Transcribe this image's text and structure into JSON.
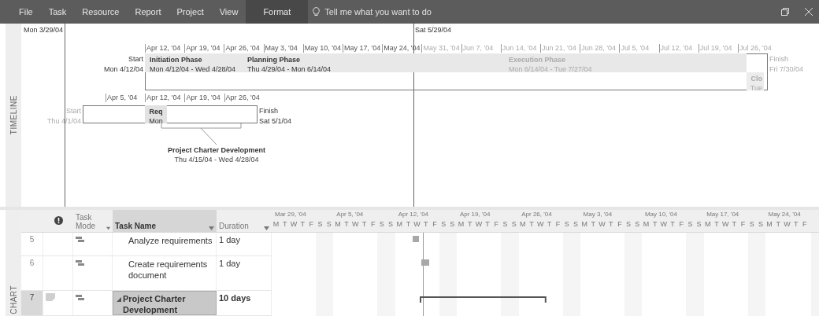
{
  "ribbon": {
    "tabs": [
      {
        "label": "File",
        "selected": false
      },
      {
        "label": "Task",
        "selected": false
      },
      {
        "label": "Resource",
        "selected": false
      },
      {
        "label": "Report",
        "selected": false
      },
      {
        "label": "Project",
        "selected": false
      },
      {
        "label": "View",
        "selected": false
      },
      {
        "label": "Format",
        "selected": true
      }
    ],
    "tell_me": {
      "placeholder": "Tell me what you want to do"
    }
  },
  "timeline": {
    "label": "TIMELINE",
    "left_date": "Mon 3/29/04",
    "marker_date": "Sat 5/29/04",
    "bars": [
      {
        "ticks": [
          {
            "label": "Apr 12, '04",
            "dimmed": false
          },
          {
            "label": "Apr 19, '04",
            "dimmed": false
          },
          {
            "label": "Apr 26, '04",
            "dimmed": false
          },
          {
            "label": "May 3, '04",
            "dimmed": false
          },
          {
            "label": "May 10, '04",
            "dimmed": false
          },
          {
            "label": "May 17, '04",
            "dimmed": false
          },
          {
            "label": "May 24, '04",
            "dimmed": false
          },
          {
            "label": "May 31, '04",
            "dimmed": true
          },
          {
            "label": "Jun 7, '04",
            "dimmed": true
          },
          {
            "label": "Jun 14, '04",
            "dimmed": true
          },
          {
            "label": "Jun 21, '04",
            "dimmed": true
          },
          {
            "label": "Jun 28, '04",
            "dimmed": true
          },
          {
            "label": "Jul 5, '04",
            "dimmed": true
          },
          {
            "label": "Jul 12, '04",
            "dimmed": true
          },
          {
            "label": "Jul 19, '04",
            "dimmed": true
          },
          {
            "label": "Jul 26, '04",
            "dimmed": true
          }
        ],
        "start_label": "Start",
        "start_date": "Mon 4/12/04",
        "start_dimmed": false,
        "finish_label": "Finish",
        "finish_date": "Fri 7/30/04",
        "finish_dimmed": true,
        "tasks": [
          {
            "name": "Initiation Phase",
            "dates": "Mon 4/12/04 - Wed 4/28/04",
            "dimmed": false
          },
          {
            "name": "Planning Phase",
            "dates": "Thu 4/29/04 - Mon 6/14/04",
            "dimmed": false
          },
          {
            "name": "Execution Phase",
            "dates": "Mon 6/14/04 - Tue 7/27/04",
            "dimmed": true
          },
          {
            "name": "Clo",
            "dates": "Tue",
            "dimmed": true
          }
        ]
      },
      {
        "ticks": [
          {
            "label": "Apr 5, '04",
            "dimmed": false
          },
          {
            "label": "Apr 12, '04",
            "dimmed": false
          },
          {
            "label": "Apr 19, '04",
            "dimmed": false
          },
          {
            "label": "Apr 26, '04",
            "dimmed": false
          }
        ],
        "start_label": "Start",
        "start_date": "Thu 4/1/04",
        "start_dimmed": true,
        "finish_label": "Finish",
        "finish_date": "Sat 5/1/04",
        "finish_dimmed": false,
        "tasks": [
          {
            "name": "Req",
            "dates": "Mon",
            "dimmed": false
          }
        ]
      }
    ],
    "callout": {
      "name": "Project Charter Development",
      "dates": "Thu 4/15/04 - Wed 4/28/04"
    }
  },
  "gantt": {
    "label": "CHART",
    "columns": {
      "mode": "Task Mode",
      "name": "Task Name",
      "duration": "Duration"
    },
    "weeks": [
      {
        "label": "Mar 29, '04",
        "days": [
          "M",
          "T",
          "W",
          "T",
          "F",
          "S",
          "S"
        ]
      },
      {
        "label": "Apr 5, '04",
        "days": [
          "M",
          "T",
          "W",
          "T",
          "F",
          "S",
          "S"
        ]
      },
      {
        "label": "Apr 12, '04",
        "days": [
          "M",
          "T",
          "W",
          "T",
          "F",
          "S",
          "S"
        ]
      },
      {
        "label": "Apr 19, '04",
        "days": [
          "M",
          "T",
          "W",
          "T",
          "F",
          "S",
          "S"
        ]
      },
      {
        "label": "Apr 26, '04",
        "days": [
          "M",
          "T",
          "W",
          "T",
          "F",
          "S",
          "S"
        ]
      },
      {
        "label": "May 3, '04",
        "days": [
          "M",
          "T",
          "W",
          "T",
          "F",
          "S",
          "S"
        ]
      },
      {
        "label": "May 10, '04",
        "days": [
          "M",
          "T",
          "W",
          "T",
          "F",
          "S",
          "S"
        ]
      },
      {
        "label": "May 17, '04",
        "days": [
          "M",
          "T",
          "W",
          "T",
          "F",
          "S",
          "S"
        ]
      },
      {
        "label": "May 24, '04",
        "days": [
          "M",
          "T",
          "W",
          "T",
          "F"
        ]
      }
    ],
    "rows": [
      {
        "id": "5",
        "kind": "task",
        "name": "Analyze requirements",
        "duration": "1 day",
        "selected": false,
        "note": false
      },
      {
        "id": "6",
        "kind": "task",
        "name": "Create requirements document",
        "duration": "1 day",
        "selected": false,
        "note": false
      },
      {
        "id": "7",
        "kind": "summary",
        "name": "Project Charter Development",
        "duration": "10 days",
        "selected": true,
        "note": true
      }
    ]
  }
}
